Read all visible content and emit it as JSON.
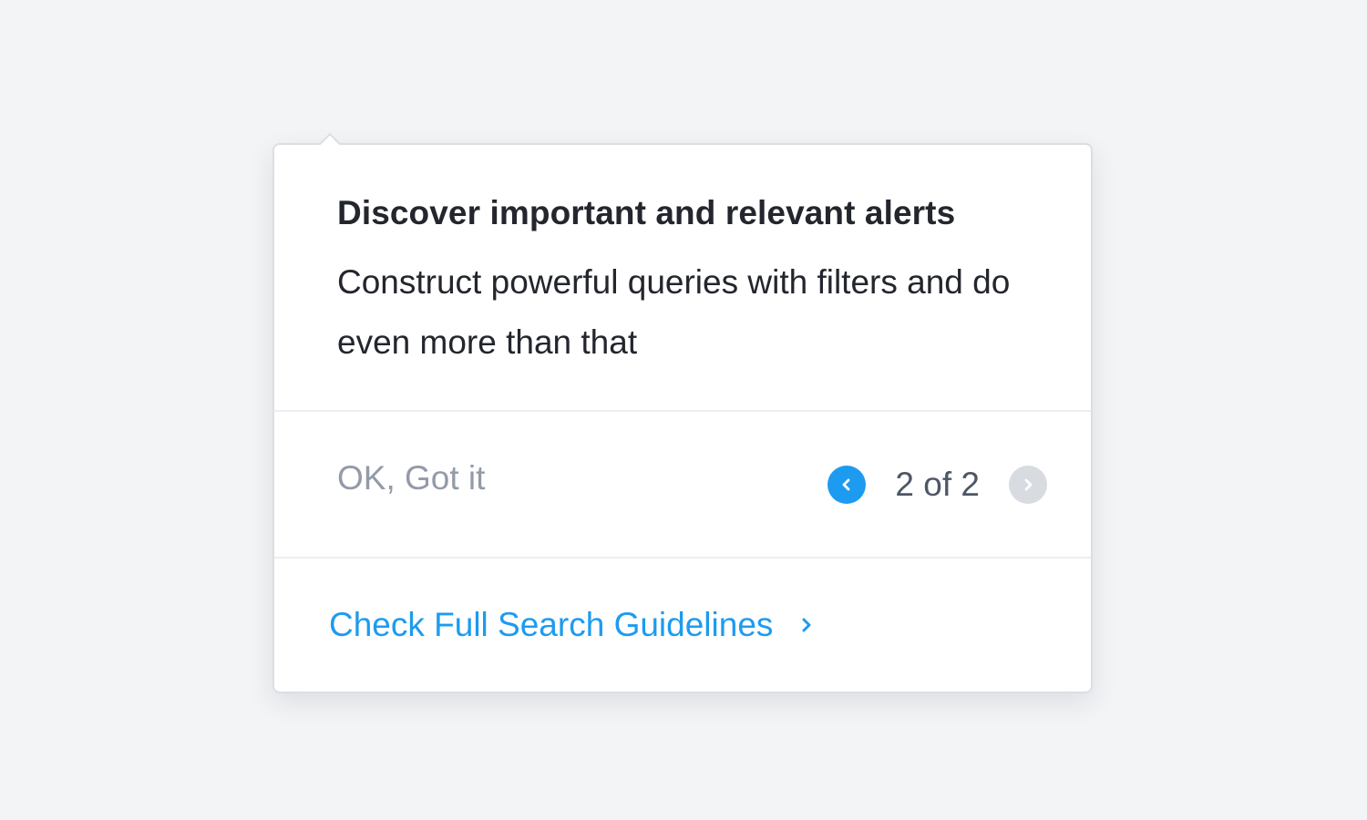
{
  "tour": {
    "title": "Discover important and relevant alerts",
    "description": "Construct powerful queries with filters and do even more than that",
    "dismiss_label": "OK, Got it",
    "pagination": {
      "current": 2,
      "total": 2,
      "label": "2 of 2",
      "prev_enabled": true,
      "next_enabled": false
    },
    "link_label": "Check Full Search Guidelines"
  },
  "icons": {
    "prev": "chevron-left-icon",
    "next": "chevron-right-icon",
    "link_arrow": "chevron-right-icon"
  },
  "colors": {
    "accent": "#1d9bf0",
    "disabled": "#d8dbe0",
    "muted_text": "#939aa8",
    "text": "#23262d",
    "background": "#f3f4f6"
  }
}
